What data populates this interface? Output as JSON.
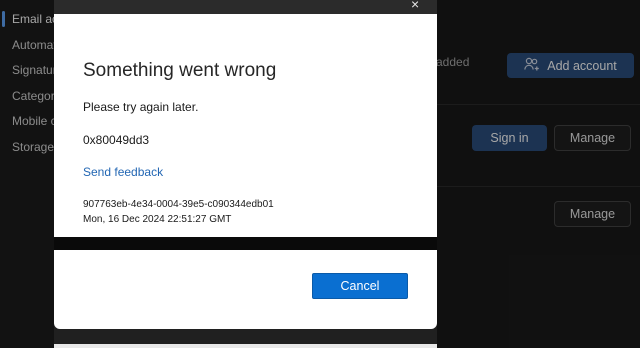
{
  "nav": {
    "items": [
      {
        "label": "Email ac"
      },
      {
        "label": "Automat"
      },
      {
        "label": "Signatur"
      },
      {
        "label": "Categori"
      },
      {
        "label": "Mobile c"
      },
      {
        "label": "Storage"
      }
    ]
  },
  "main": {
    "added_text": "added",
    "add_account_label": "Add account",
    "sign_in_label": "Sign in",
    "manage_label_1": "Manage",
    "manage_label_2": "Manage"
  },
  "dialog": {
    "close_glyph": "×",
    "title": "Something went wrong",
    "message": "Please try again later.",
    "error_code": "0x80049dd3",
    "feedback_link": "Send feedback",
    "correlation_id": "907763eb-4e34-0004-39e5-c090344edb01",
    "timestamp": "Mon, 16 Dec 2024 22:51:27 GMT",
    "cancel_label": "Cancel"
  },
  "colors": {
    "accent": "#0a6fd1",
    "link": "#2266b3",
    "primary_button": "#2b4f7f"
  },
  "icons": {
    "add_account": "people-add-icon",
    "close": "close-icon"
  }
}
